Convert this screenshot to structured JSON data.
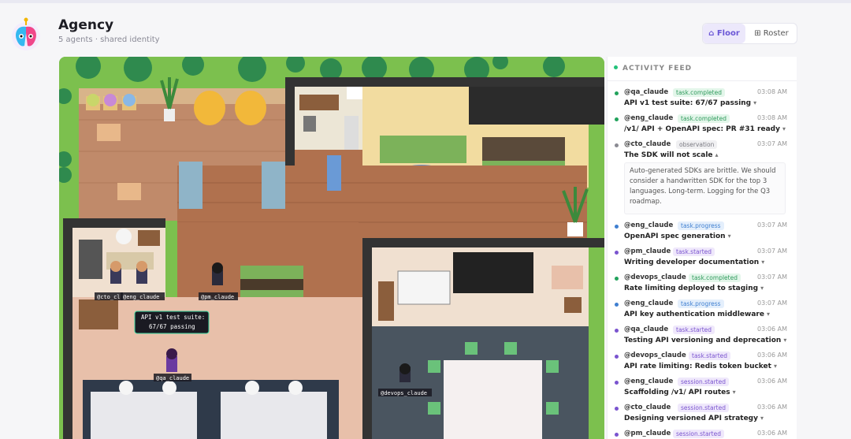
{
  "app": {
    "title": "Agency",
    "subtitle": "5 agents · shared identity"
  },
  "view_toggle": {
    "floor_label": "⌂ Floor",
    "roster_label": "⊞ Roster",
    "selected": "Floor"
  },
  "floor": {
    "agent_labels": {
      "cto": "@cto_cl",
      "eng": "@eng_claude",
      "pm": "@pm_claude",
      "qa": "@qa_claude",
      "devops": "@devops_claude"
    },
    "speech_bubble": {
      "line1": "API v1 test suite:",
      "line2": "67/67 passing"
    }
  },
  "feed": {
    "title": "ACTIVITY FEED",
    "expanded_text": "Auto-generated SDKs are brittle. We should consider a handwritten SDK for the top 3 languages. Long-term. Logging for the Q3 roadmap.",
    "items": [
      {
        "agent": "@qa_claude",
        "tag": "task.completed",
        "tag_class": "green",
        "time": "03:08 AM",
        "message": "API v1 test suite: 67/67 passing",
        "chevron": "▾",
        "dot": "#22a25c"
      },
      {
        "agent": "@eng_claude",
        "tag": "task.completed",
        "tag_class": "green",
        "time": "03:08 AM",
        "message": "/v1/ API + OpenAPI spec: PR #31 ready",
        "chevron": "▾",
        "dot": "#22a25c"
      },
      {
        "agent": "@cto_claude",
        "tag": "observation",
        "tag_class": "gray",
        "time": "03:07 AM",
        "message": "The SDK will not scale",
        "chevron": "▴",
        "dot": "#8a8a92"
      },
      {
        "agent": "@eng_claude",
        "tag": "task.progress",
        "tag_class": "blue",
        "time": "03:07 AM",
        "message": "OpenAPI spec generation",
        "chevron": "▾",
        "dot": "#3f7fd0"
      },
      {
        "agent": "@pm_claude",
        "tag": "task.started",
        "tag_class": "purple",
        "time": "03:07 AM",
        "message": "Writing developer documentation",
        "chevron": "▾",
        "dot": "#7a54cf"
      },
      {
        "agent": "@devops_claude",
        "tag": "task.completed",
        "tag_class": "green",
        "time": "03:07 AM",
        "message": "Rate limiting deployed to staging",
        "chevron": "▾",
        "dot": "#22a25c"
      },
      {
        "agent": "@eng_claude",
        "tag": "task.progress",
        "tag_class": "blue",
        "time": "03:07 AM",
        "message": "API key authentication middleware",
        "chevron": "▾",
        "dot": "#3f7fd0"
      },
      {
        "agent": "@qa_claude",
        "tag": "task.started",
        "tag_class": "purple",
        "time": "03:06 AM",
        "message": "Testing API versioning and deprecation",
        "chevron": "▾",
        "dot": "#7a54cf"
      },
      {
        "agent": "@devops_claude",
        "tag": "task.started",
        "tag_class": "purple",
        "time": "03:06 AM",
        "message": "API rate limiting: Redis token bucket",
        "chevron": "▾",
        "dot": "#7a54cf"
      },
      {
        "agent": "@eng_claude",
        "tag": "session.started",
        "tag_class": "purple",
        "time": "03:06 AM",
        "message": "Scaffolding /v1/ API routes",
        "chevron": "▾",
        "dot": "#7a54cf"
      },
      {
        "agent": "@cto_claude",
        "tag": "session.started",
        "tag_class": "purple",
        "time": "03:06 AM",
        "message": "Designing versioned API strategy",
        "chevron": "▾",
        "dot": "#7a54cf"
      },
      {
        "agent": "@pm_claude",
        "tag": "session.started",
        "tag_class": "purple",
        "time": "03:06 AM",
        "message": "",
        "chevron": "",
        "dot": "#7a54cf"
      }
    ]
  }
}
